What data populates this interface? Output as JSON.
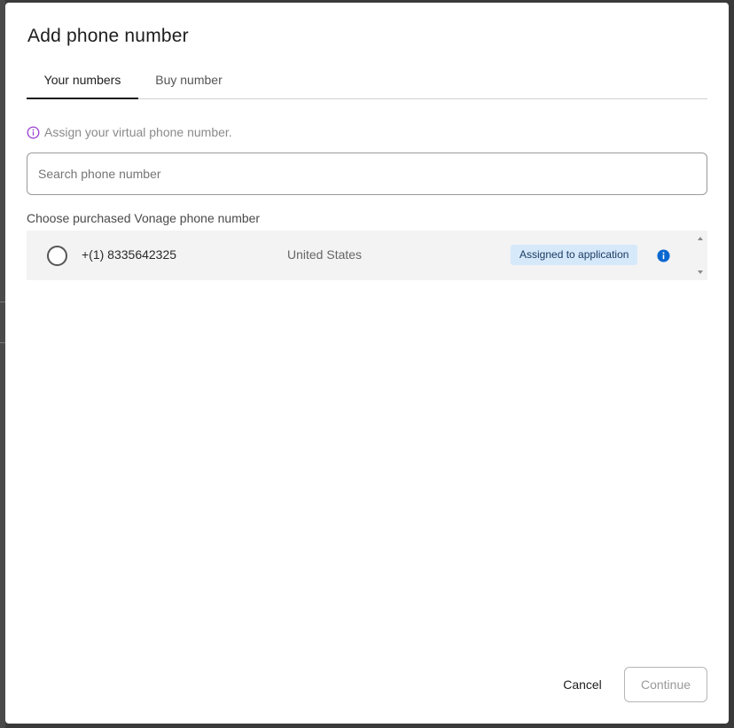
{
  "dialog": {
    "title": "Add phone number"
  },
  "tabs": [
    {
      "label": "Your numbers",
      "active": true
    },
    {
      "label": "Buy number",
      "active": false
    }
  ],
  "hint": {
    "icon": "info-circle-icon",
    "text": "Assign your virtual phone number.",
    "icon_color": "#9b3fd1"
  },
  "search": {
    "placeholder": "Search phone number",
    "value": ""
  },
  "list": {
    "label": "Choose purchased Vonage phone number",
    "rows": [
      {
        "phone": "+(1) 8335642325",
        "country": "United States",
        "badge": "Assigned to application",
        "selected": false
      }
    ]
  },
  "footer": {
    "cancel_label": "Cancel",
    "continue_label": "Continue"
  },
  "colors": {
    "badge_bg": "#d6e9fb",
    "info_blue": "#0b67d0",
    "list_bg": "#f3f3f3"
  }
}
